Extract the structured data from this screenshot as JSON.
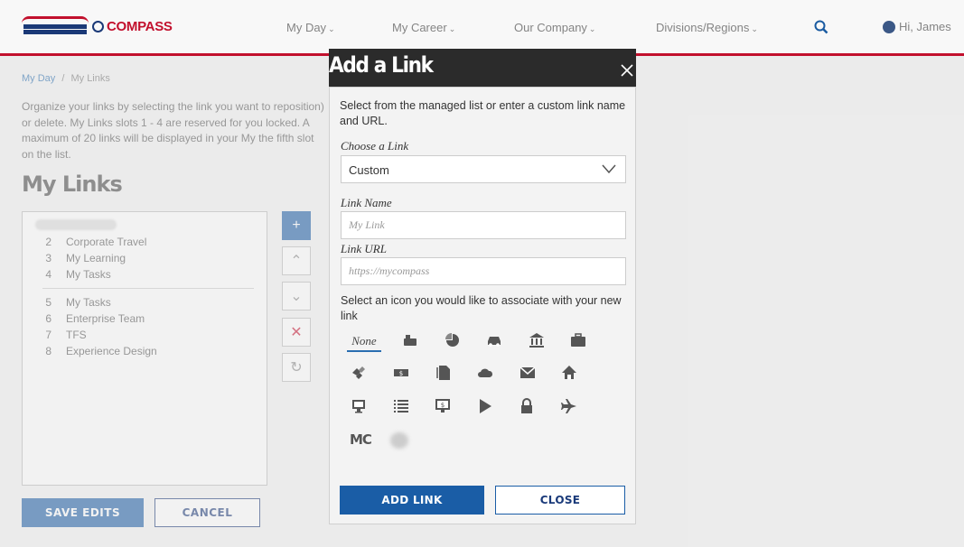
{
  "header": {
    "nav": [
      {
        "label": "My Day"
      },
      {
        "label": "My Career"
      },
      {
        "label": "Our Company"
      },
      {
        "label": "Divisions/Regions"
      }
    ],
    "user_greeting": "Hi, James",
    "logo_text": "COMPASS"
  },
  "page": {
    "breadcrumb": {
      "home": "My Day",
      "sep": "/",
      "current": "My Links"
    },
    "intro": "Organize your links by selecting the link you want to reposition) or delete. My Links slots 1 - 4 are reserved for you locked. A maximum of 20 links will be displayed in your My the fifth slot on the list.",
    "title": "My Links",
    "links": [
      {
        "num": "2",
        "name": "Corporate Travel"
      },
      {
        "num": "3",
        "name": "My Learning"
      },
      {
        "num": "4",
        "name": "My Tasks"
      },
      {
        "num": "5",
        "name": "My Tasks"
      },
      {
        "num": "6",
        "name": "Enterprise Team"
      },
      {
        "num": "7",
        "name": "TFS"
      },
      {
        "num": "8",
        "name": "Experience Design"
      }
    ],
    "save_label": "SAVE EDITS",
    "cancel_label": "CANCEL"
  },
  "modal": {
    "title": "Add a Link",
    "intro": "Select from the managed list or enter a custom link name and URL.",
    "choose_label": "Choose a Link",
    "choose_value": "Custom",
    "name_label": "Link Name",
    "name_placeholder": "My Link",
    "url_label": "Link URL",
    "url_placeholder": "https://mycompass",
    "icon_label": "Select an icon you would like to associate with your new link",
    "none_option": "None",
    "mc_option": "MC",
    "icons": [
      "briefcase-stack-icon",
      "pie-chart-icon",
      "car-icon",
      "bank-icon",
      "briefcase-icon",
      "handshake-icon",
      "money-icon",
      "document-icon",
      "cloud-icon",
      "envelope-icon",
      "home-icon",
      "desktop-icon",
      "list-icon",
      "monitor-dollar-icon",
      "play-icon",
      "lock-icon",
      "airplane-icon"
    ],
    "add_label": "ADD LINK",
    "close_label": "CLOSE"
  },
  "colors": {
    "brand_blue": "#1a5da6",
    "brand_red": "#c8102e"
  }
}
